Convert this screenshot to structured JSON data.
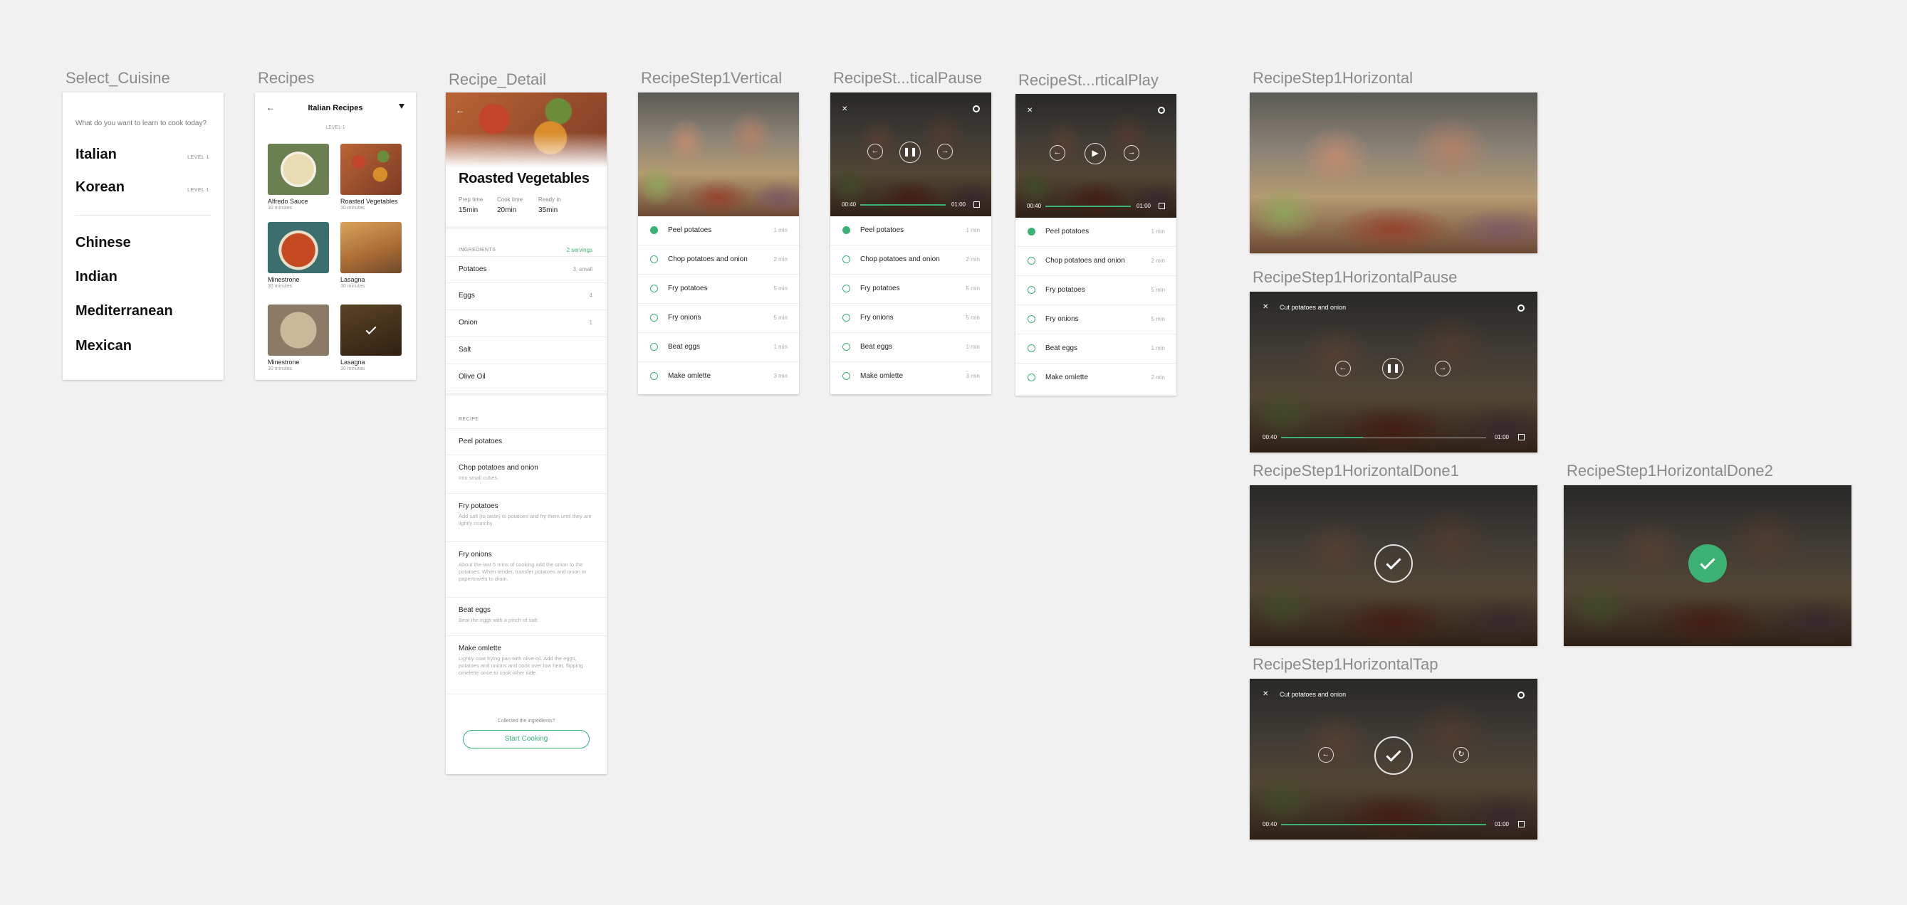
{
  "artboards": {
    "select_cuisine": "Select_Cuisine",
    "recipes": "Recipes",
    "recipe_detail": "Recipe_Detail",
    "step_vertical": "RecipeStep1Vertical",
    "step_vertical_pause": "RecipeSt...ticalPause",
    "step_vertical_play": "RecipeSt...rticalPlay",
    "step_horizontal": "RecipeStep1Horizontal",
    "step_horizontal_pause": "RecipeStep1HorizontalPause",
    "step_horizontal_done1": "RecipeStep1HorizontalDone1",
    "step_horizontal_done2": "RecipeStep1HorizontalDone2",
    "step_horizontal_tap": "RecipeStep1HorizontalTap"
  },
  "select_cuisine": {
    "question": "What do you want to learn to cook today?",
    "level_label": "LEVEL 1",
    "cuisines": [
      "Italian",
      "Korean",
      "Chinese",
      "Indian",
      "Mediterranean",
      "Mexican"
    ]
  },
  "recipes": {
    "title": "Italian Recipes",
    "level": "LEVEL 1",
    "items": [
      {
        "title": "Alfredo Sauce",
        "time": "30 minutes"
      },
      {
        "title": "Roasted Vegetables",
        "time": "30 minutes"
      },
      {
        "title": "Minestrone",
        "time": "30 minutes"
      },
      {
        "title": "Lasagna",
        "time": "30 minutes"
      },
      {
        "title": "Minestrone",
        "time": "30 minutes"
      },
      {
        "title": "Lasagna",
        "time": "30 minutes"
      }
    ]
  },
  "recipe_detail": {
    "title": "Roasted Vegetables",
    "prep_label": "Prep time",
    "prep_value": "15min",
    "cook_label": "Cook time",
    "cook_value": "20min",
    "ready_label": "Ready in",
    "ready_value": "35min",
    "ingredients_label": "INGREDIENTS",
    "servings": "2 servings",
    "ingredients": [
      {
        "name": "Potatoes",
        "qty": "3, small"
      },
      {
        "name": "Eggs",
        "qty": "4"
      },
      {
        "name": "Onion",
        "qty": "1"
      },
      {
        "name": "Salt",
        "qty": ""
      },
      {
        "name": "Olive Oil",
        "qty": ""
      }
    ],
    "recipe_label": "RECIPE",
    "steps": [
      {
        "name": "Peel potatoes",
        "desc": ""
      },
      {
        "name": "Chop potatoes and onion",
        "desc": "Into small cubes."
      },
      {
        "name": "Fry potatoes",
        "desc": "Add salt (to taste) to potatoes and fry them until they are lightly crunchy."
      },
      {
        "name": "Fry onions",
        "desc": "About the last 5 mins of cooking add the onion to the potatoes. When tender, transfer potatoes and onion to papertowels to drain."
      },
      {
        "name": "Beat eggs",
        "desc": "Beat the eggs with a pinch of salt."
      },
      {
        "name": "Make omlette",
        "desc": "Lightly coat frying pan with olive oil. Add the eggs, potatoes and onions and cook over low heat, flipping omelette once to cook other side."
      }
    ],
    "collected": "Collected the ingredients?",
    "start_button": "Start Cooking"
  },
  "vertical_steps": [
    {
      "name": "Peel potatoes",
      "time": "1 min"
    },
    {
      "name": "Chop potatoes and onion",
      "time": "2 min"
    },
    {
      "name": "Fry potatoes",
      "time": "5 min"
    },
    {
      "name": "Fry onions",
      "time": "5 min"
    },
    {
      "name": "Beat eggs",
      "time": "1 min"
    },
    {
      "name": "Make omlette",
      "time": "3 min"
    }
  ],
  "vertical_play_steps_last_time": "2 min",
  "video": {
    "caption": "Cut potatoes and onion",
    "elapsed": "00:40",
    "total": "01:00",
    "progress": 0.4
  },
  "icons": {
    "close": "close-icon",
    "settings": "gear-icon",
    "previous": "arrow-left-icon",
    "next": "arrow-right-icon",
    "pause": "pause-icon",
    "play": "play-icon",
    "replay": "replay-icon",
    "fullscreen": "fullscreen-icon",
    "check": "check-icon"
  },
  "colors": {
    "accent": "#3bb273",
    "background": "#f1f1f1"
  }
}
